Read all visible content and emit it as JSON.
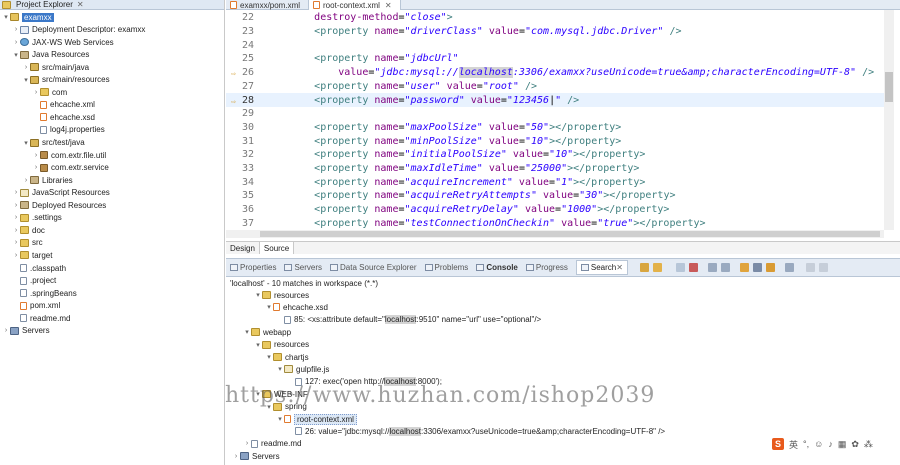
{
  "explorer": {
    "title": "Project Explorer",
    "items": [
      {
        "label": "examxx",
        "level": 0,
        "twisty": "▾",
        "icon": "project-icon",
        "selected": true
      },
      {
        "label": "Deployment Descriptor: examxx",
        "level": 1,
        "twisty": "›",
        "icon": "descriptor-icon"
      },
      {
        "label": "JAX-WS Web Services",
        "level": 1,
        "twisty": "›",
        "icon": "webservice-icon"
      },
      {
        "label": "Java Resources",
        "level": 1,
        "twisty": "▾",
        "icon": "java-resources-icon"
      },
      {
        "label": "src/main/java",
        "level": 2,
        "twisty": "›",
        "icon": "source-folder-icon"
      },
      {
        "label": "src/main/resources",
        "level": 2,
        "twisty": "▾",
        "icon": "source-folder-icon"
      },
      {
        "label": "com",
        "level": 3,
        "twisty": "›",
        "icon": "folder-icon"
      },
      {
        "label": "ehcache.xml",
        "level": 3,
        "twisty": "",
        "icon": "xml-file-icon"
      },
      {
        "label": "ehcache.xsd",
        "level": 3,
        "twisty": "",
        "icon": "xsd-file-icon"
      },
      {
        "label": "log4j.properties",
        "level": 3,
        "twisty": "",
        "icon": "properties-file-icon"
      },
      {
        "label": "src/test/java",
        "level": 2,
        "twisty": "▾",
        "icon": "source-folder-icon"
      },
      {
        "label": "com.extr.file.util",
        "level": 3,
        "twisty": "›",
        "icon": "package-icon"
      },
      {
        "label": "com.extr.service",
        "level": 3,
        "twisty": "›",
        "icon": "package-icon"
      },
      {
        "label": "Libraries",
        "level": 2,
        "twisty": "›",
        "icon": "library-icon"
      },
      {
        "label": "JavaScript Resources",
        "level": 1,
        "twisty": "›",
        "icon": "javascript-icon"
      },
      {
        "label": "Deployed Resources",
        "level": 1,
        "twisty": "›",
        "icon": "deployed-icon"
      },
      {
        "label": ".settings",
        "level": 1,
        "twisty": "›",
        "icon": "folder-icon"
      },
      {
        "label": "doc",
        "level": 1,
        "twisty": "›",
        "icon": "folder-icon"
      },
      {
        "label": "src",
        "level": 1,
        "twisty": "›",
        "icon": "folder-icon"
      },
      {
        "label": "target",
        "level": 1,
        "twisty": "›",
        "icon": "folder-icon"
      },
      {
        "label": ".classpath",
        "level": 1,
        "twisty": "",
        "icon": "file-icon"
      },
      {
        "label": ".project",
        "level": 1,
        "twisty": "",
        "icon": "file-icon"
      },
      {
        "label": ".springBeans",
        "level": 1,
        "twisty": "",
        "icon": "file-icon"
      },
      {
        "label": "pom.xml",
        "level": 1,
        "twisty": "",
        "icon": "xml-file-icon"
      },
      {
        "label": "readme.md",
        "level": 1,
        "twisty": "",
        "icon": "file-icon"
      },
      {
        "label": "Servers",
        "level": 0,
        "twisty": "›",
        "icon": "servers-icon"
      }
    ]
  },
  "editor": {
    "tabs": [
      {
        "label": "examxx/pom.xml",
        "active": false
      },
      {
        "label": "root-context.xml",
        "active": true
      }
    ],
    "lines": [
      {
        "num": "22",
        "indent": "        ",
        "parts": [
          [
            "attr",
            "destroy-method"
          ],
          [
            "plain",
            "="
          ],
          [
            "val",
            "\"close\""
          ],
          [
            "tag",
            ">"
          ]
        ]
      },
      {
        "num": "23",
        "indent": "        ",
        "parts": [
          [
            "tag",
            "<property "
          ],
          [
            "attr",
            "name"
          ],
          [
            "plain",
            "="
          ],
          [
            "val",
            "\"driverClass\""
          ],
          [
            "plain",
            " "
          ],
          [
            "attr",
            "value"
          ],
          [
            "plain",
            "="
          ],
          [
            "val",
            "\"com.mysql.jdbc.Driver\""
          ],
          [
            "plain",
            " "
          ],
          [
            "tag",
            "/>"
          ]
        ]
      },
      {
        "num": "24",
        "indent": "",
        "parts": []
      },
      {
        "num": "25",
        "indent": "        ",
        "parts": [
          [
            "tag",
            "<property "
          ],
          [
            "attr",
            "name"
          ],
          [
            "plain",
            "="
          ],
          [
            "val",
            "\"jdbcUrl\""
          ]
        ]
      },
      {
        "num": "26",
        "indent": "            ",
        "marker": "⇨",
        "parts": [
          [
            "attr",
            "value"
          ],
          [
            "plain",
            "="
          ],
          [
            "val",
            "\"jdbc:mysql://"
          ],
          [
            "valmark",
            "localhost"
          ],
          [
            "val",
            ":3306/examxx?useUnicode=true&amp;characterEncoding=UTF-8\""
          ],
          [
            "plain",
            " "
          ],
          [
            "tag",
            "/>"
          ]
        ]
      },
      {
        "num": "27",
        "indent": "        ",
        "parts": [
          [
            "tag",
            "<property "
          ],
          [
            "attr",
            "name"
          ],
          [
            "plain",
            "="
          ],
          [
            "val",
            "\"user\""
          ],
          [
            "plain",
            " "
          ],
          [
            "attr",
            "value"
          ],
          [
            "plain",
            "="
          ],
          [
            "val",
            "\"root\""
          ],
          [
            "plain",
            " "
          ],
          [
            "tag",
            "/>"
          ]
        ]
      },
      {
        "num": "28",
        "indent": "        ",
        "marker": "⇨",
        "current": true,
        "parts": [
          [
            "tag",
            "<property "
          ],
          [
            "attr",
            "name"
          ],
          [
            "plain",
            "="
          ],
          [
            "val",
            "\"password\""
          ],
          [
            "plain",
            " "
          ],
          [
            "attr",
            "value"
          ],
          [
            "plain",
            "="
          ],
          [
            "val",
            "\"123456"
          ],
          [
            "plain",
            "|"
          ],
          [
            "val",
            "\""
          ],
          [
            "plain",
            " "
          ],
          [
            "tag",
            "/>"
          ]
        ]
      },
      {
        "num": "29",
        "indent": "",
        "parts": []
      },
      {
        "num": "30",
        "indent": "        ",
        "parts": [
          [
            "tag",
            "<property "
          ],
          [
            "attr",
            "name"
          ],
          [
            "plain",
            "="
          ],
          [
            "val",
            "\"maxPoolSize\""
          ],
          [
            "plain",
            " "
          ],
          [
            "attr",
            "value"
          ],
          [
            "plain",
            "="
          ],
          [
            "val",
            "\"50\""
          ],
          [
            "tag",
            "></property>"
          ]
        ]
      },
      {
        "num": "31",
        "indent": "        ",
        "parts": [
          [
            "tag",
            "<property "
          ],
          [
            "attr",
            "name"
          ],
          [
            "plain",
            "="
          ],
          [
            "val",
            "\"minPoolSize\""
          ],
          [
            "plain",
            " "
          ],
          [
            "attr",
            "value"
          ],
          [
            "plain",
            "="
          ],
          [
            "val",
            "\"10\""
          ],
          [
            "tag",
            "></property>"
          ]
        ]
      },
      {
        "num": "32",
        "indent": "        ",
        "parts": [
          [
            "tag",
            "<property "
          ],
          [
            "attr",
            "name"
          ],
          [
            "plain",
            "="
          ],
          [
            "val",
            "\"initialPoolSize\""
          ],
          [
            "plain",
            " "
          ],
          [
            "attr",
            "value"
          ],
          [
            "plain",
            "="
          ],
          [
            "val",
            "\"10\""
          ],
          [
            "tag",
            "></property>"
          ]
        ]
      },
      {
        "num": "33",
        "indent": "        ",
        "parts": [
          [
            "tag",
            "<property "
          ],
          [
            "attr",
            "name"
          ],
          [
            "plain",
            "="
          ],
          [
            "val",
            "\"maxIdleTime\""
          ],
          [
            "plain",
            " "
          ],
          [
            "attr",
            "value"
          ],
          [
            "plain",
            "="
          ],
          [
            "val",
            "\"25000\""
          ],
          [
            "tag",
            "></property>"
          ]
        ]
      },
      {
        "num": "34",
        "indent": "        ",
        "parts": [
          [
            "tag",
            "<property "
          ],
          [
            "attr",
            "name"
          ],
          [
            "plain",
            "="
          ],
          [
            "val",
            "\"acquireIncrement\""
          ],
          [
            "plain",
            " "
          ],
          [
            "attr",
            "value"
          ],
          [
            "plain",
            "="
          ],
          [
            "val",
            "\"1\""
          ],
          [
            "tag",
            "></property>"
          ]
        ]
      },
      {
        "num": "35",
        "indent": "        ",
        "parts": [
          [
            "tag",
            "<property "
          ],
          [
            "attr",
            "name"
          ],
          [
            "plain",
            "="
          ],
          [
            "val",
            "\"acquireRetryAttempts\""
          ],
          [
            "plain",
            " "
          ],
          [
            "attr",
            "value"
          ],
          [
            "plain",
            "="
          ],
          [
            "val",
            "\"30\""
          ],
          [
            "tag",
            "></property>"
          ]
        ]
      },
      {
        "num": "36",
        "indent": "        ",
        "parts": [
          [
            "tag",
            "<property "
          ],
          [
            "attr",
            "name"
          ],
          [
            "plain",
            "="
          ],
          [
            "val",
            "\"acquireRetryDelay\""
          ],
          [
            "plain",
            " "
          ],
          [
            "attr",
            "value"
          ],
          [
            "plain",
            "="
          ],
          [
            "val",
            "\"1000\""
          ],
          [
            "tag",
            "></property>"
          ]
        ]
      },
      {
        "num": "37",
        "indent": "        ",
        "parts": [
          [
            "tag",
            "<property "
          ],
          [
            "attr",
            "name"
          ],
          [
            "plain",
            "="
          ],
          [
            "val",
            "\"testConnectionOnCheckin\""
          ],
          [
            "plain",
            " "
          ],
          [
            "attr",
            "value"
          ],
          [
            "plain",
            "="
          ],
          [
            "val",
            "\"true\""
          ],
          [
            "tag",
            "></property>"
          ]
        ]
      }
    ],
    "source_tabs": {
      "design": "Design",
      "source": "Source"
    }
  },
  "views": {
    "tabs": [
      {
        "label": "Properties",
        "icon": "properties-icon",
        "active": false
      },
      {
        "label": "Servers",
        "icon": "servers-icon",
        "active": false
      },
      {
        "label": "Data Source Explorer",
        "icon": "data-source-icon",
        "active": false
      },
      {
        "label": "Problems",
        "icon": "problems-icon",
        "active": false
      },
      {
        "label": "Console",
        "icon": "console-icon",
        "active": false,
        "bold": true
      },
      {
        "label": "Progress",
        "icon": "progress-icon",
        "active": false
      },
      {
        "label": "Search",
        "icon": "search-icon",
        "active": true
      }
    ],
    "search_summary": "'localhost' - 10 matches in workspace (*.*)",
    "results": [
      {
        "indent": 2,
        "twisty": "▾",
        "icon": "folder-icon",
        "text": "resources"
      },
      {
        "indent": 3,
        "twisty": "▾",
        "icon": "xsd-file-icon",
        "text": "ehcache.xsd"
      },
      {
        "indent": 4,
        "twisty": "",
        "icon": "match-icon",
        "prefix": "85: <xs:attribute default=\"",
        "hit": "localhost",
        "suffix": ":9510\" name=\"url\" use=\"optional\"/>"
      },
      {
        "indent": 1,
        "twisty": "▾",
        "icon": "folder-icon",
        "text": "webapp"
      },
      {
        "indent": 2,
        "twisty": "▾",
        "icon": "folder-icon",
        "text": "resources"
      },
      {
        "indent": 3,
        "twisty": "▾",
        "icon": "folder-icon",
        "text": "chartjs"
      },
      {
        "indent": 4,
        "twisty": "▾",
        "icon": "js-file-icon",
        "text": "gulpfile.js"
      },
      {
        "indent": 5,
        "twisty": "",
        "icon": "match-icon",
        "prefix": "127: exec('open http://",
        "hit": "localhost",
        "suffix": ":8000');"
      },
      {
        "indent": 2,
        "twisty": "▾",
        "icon": "folder-icon",
        "text": "WEB-INF"
      },
      {
        "indent": 3,
        "twisty": "▾",
        "icon": "folder-icon",
        "text": "spring"
      },
      {
        "indent": 4,
        "twisty": "▾",
        "icon": "xml-file-icon",
        "text": "root-context.xml",
        "selected": true
      },
      {
        "indent": 5,
        "twisty": "",
        "icon": "match-icon",
        "prefix": "26: value=\"jdbc:mysql://",
        "hit": "localhost",
        "suffix": ":3306/examxx?useUnicode=true&amp;characterEncoding=UTF-8\" />"
      },
      {
        "indent": 1,
        "twisty": "›",
        "icon": "file-icon",
        "text": "readme.md"
      },
      {
        "indent": 0,
        "twisty": "›",
        "icon": "servers-icon",
        "text": "Servers"
      }
    ]
  },
  "watermark": "https://www.huzhan.com/ishop2039",
  "ime": {
    "logo": "S",
    "label": "英"
  }
}
